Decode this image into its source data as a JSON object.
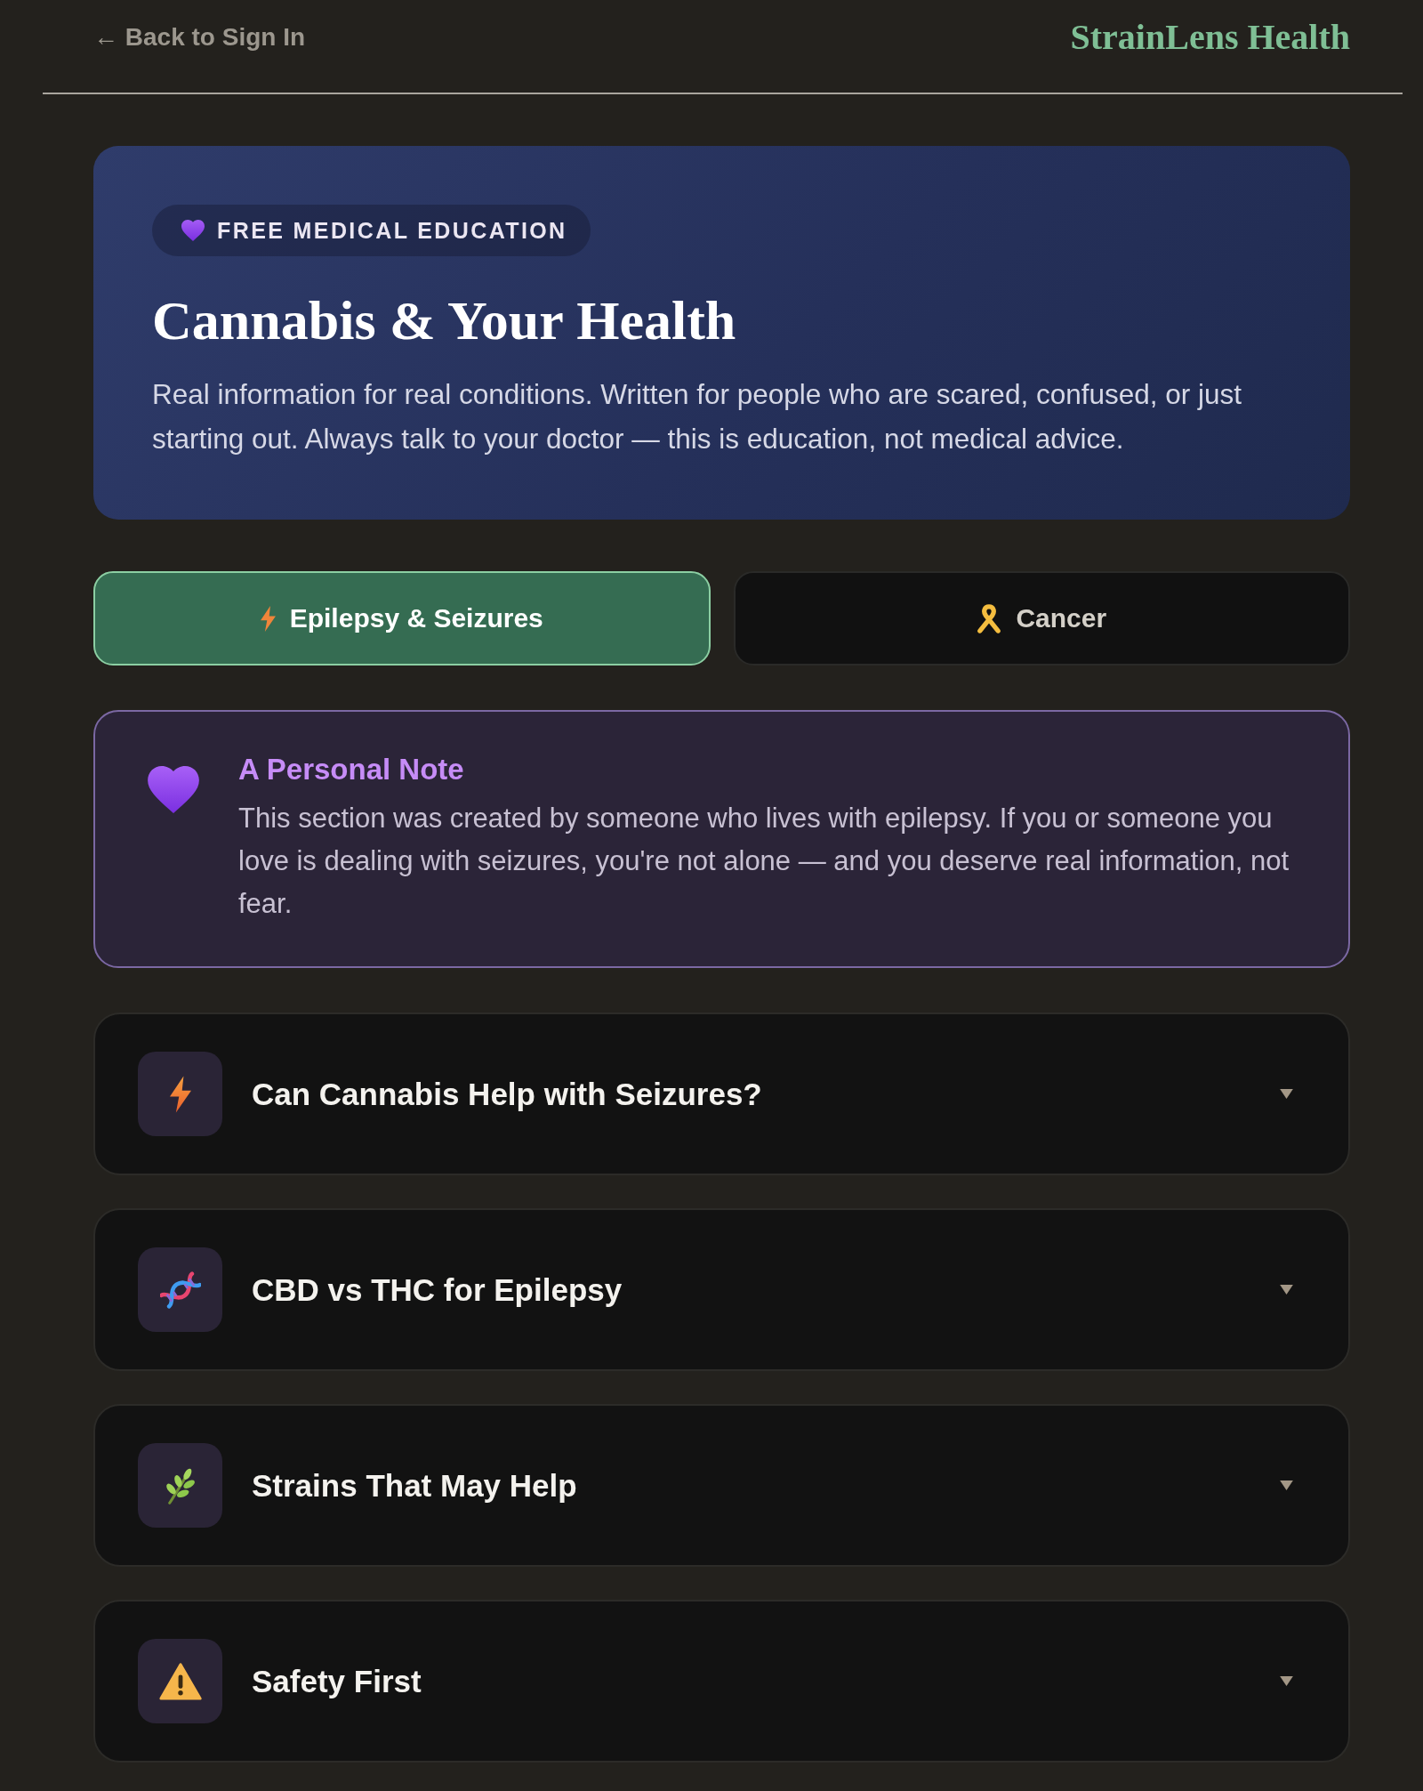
{
  "header": {
    "back_link": "← Back to Sign In",
    "brand": "StrainLens Health"
  },
  "hero": {
    "badge": "FREE MEDICAL EDUCATION",
    "title": "Cannabis & Your Health",
    "description": "Real information for real conditions. Written for people who are scared, confused, or just starting out. Always talk to your doctor — this is education, not medical advice."
  },
  "tabs": [
    {
      "label": "Epilepsy & Seizures",
      "selected": true
    },
    {
      "label": "Cancer",
      "selected": false
    }
  ],
  "note": {
    "title": "A Personal Note",
    "body": "This section was created by someone who lives with epilepsy. If you or someone you love is dealing with seizures, you're not alone — and you deserve real information, not fear."
  },
  "sections": [
    {
      "title": "Can Cannabis Help with Seizures?",
      "expanded": false
    },
    {
      "title": "CBD vs THC for Epilepsy",
      "expanded": false
    },
    {
      "title": "Strains That May Help",
      "expanded": false
    },
    {
      "title": "Safety First",
      "expanded": false
    }
  ]
}
